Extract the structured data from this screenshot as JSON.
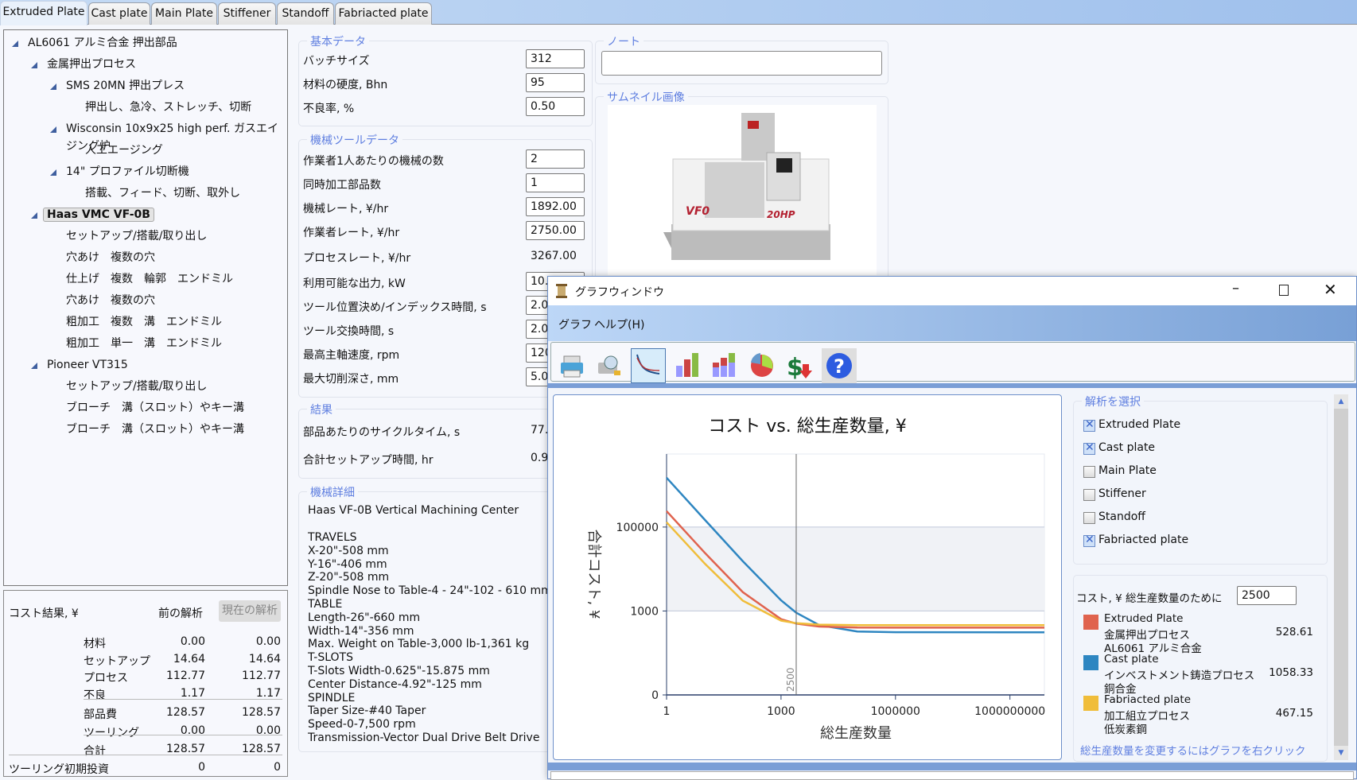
{
  "tabs": [
    "Extruded Plate",
    "Cast plate",
    "Main Plate",
    "Stiffener",
    "Standoff",
    "Fabriacted plate"
  ],
  "tree": [
    {
      "label": "AL6061 アルミ合金 押出部品",
      "level": 0,
      "toggle": true
    },
    {
      "label": "金属押出プロセス",
      "level": 1,
      "toggle": true
    },
    {
      "label": "SMS 20MN 押出プレス",
      "level": 2,
      "toggle": true
    },
    {
      "label": "押出し、急冷、ストレッチ、切断",
      "level": 3,
      "toggle": false
    },
    {
      "label": "Wisconsin 10x9x25 high perf. ガスエイジング炉",
      "level": 2,
      "toggle": true
    },
    {
      "label": "人工エージング",
      "level": 3,
      "toggle": false
    },
    {
      "label": "14\" プロファイル切断機",
      "level": 2,
      "toggle": true
    },
    {
      "label": "搭載、フィード、切断、取外し",
      "level": 3,
      "toggle": false
    },
    {
      "label": "Haas VMC VF-0B",
      "level": 1,
      "toggle": true,
      "selected": true
    },
    {
      "label": "セットアップ/搭載/取り出し",
      "level": 2,
      "toggle": false
    },
    {
      "label": "穴あけ　複数の穴",
      "level": 2,
      "toggle": false
    },
    {
      "label": "仕上げ　複数　輪郭　エンドミル",
      "level": 2,
      "toggle": false
    },
    {
      "label": "穴あけ　複数の穴",
      "level": 2,
      "toggle": false
    },
    {
      "label": "粗加工　複数　溝　エンドミル",
      "level": 2,
      "toggle": false
    },
    {
      "label": "粗加工　単一　溝　エンドミル",
      "level": 2,
      "toggle": false
    },
    {
      "label": "Pioneer VT315",
      "level": 1,
      "toggle": true
    },
    {
      "label": "セットアップ/搭載/取り出し",
      "level": 2,
      "toggle": false
    },
    {
      "label": "ブローチ　溝（スロット）やキー溝",
      "level": 2,
      "toggle": false
    },
    {
      "label": "ブローチ　溝（スロット）やキー溝",
      "level": 2,
      "toggle": false
    }
  ],
  "cost": {
    "title": "コスト結果, ¥",
    "prev_header": "前の解析",
    "current_button": "現在の解析",
    "rows": [
      {
        "label": "材料",
        "prev": "0.00",
        "cur": "0.00"
      },
      {
        "label": "セットアップ",
        "prev": "14.64",
        "cur": "14.64"
      },
      {
        "label": "プロセス",
        "prev": "112.77",
        "cur": "112.77"
      },
      {
        "label": "不良",
        "prev": "1.17",
        "cur": "1.17"
      },
      {
        "label": "部品費",
        "prev": "128.57",
        "cur": "128.57"
      },
      {
        "label": "ツーリング",
        "prev": "0.00",
        "cur": "0.00"
      },
      {
        "label": "合計",
        "prev": "128.57",
        "cur": "128.57"
      }
    ],
    "tooling": {
      "label": "ツーリング初期投資",
      "prev": "0",
      "cur": "0"
    }
  },
  "basic": {
    "title": "基本データ",
    "fields": [
      {
        "label": "バッチサイズ",
        "value": "312"
      },
      {
        "label": "材料の硬度, Bhn",
        "value": "95"
      },
      {
        "label": "不良率, %",
        "value": "0.50"
      }
    ]
  },
  "machine": {
    "title": "機械ツールデータ",
    "fields": [
      {
        "label": "作業者1人あたりの機械の数",
        "value": "2",
        "input": true
      },
      {
        "label": "同時加工部品数",
        "value": "1",
        "input": true
      },
      {
        "label": "機械レート, ¥/hr",
        "value": "1892.00",
        "input": true
      },
      {
        "label": "作業者レート, ¥/hr",
        "value": "2750.00",
        "input": true
      },
      {
        "label": "プロセスレート, ¥/hr",
        "value": "3267.00",
        "input": false
      },
      {
        "label": "利用可能な出力, kW",
        "value": "10.",
        "input": true
      },
      {
        "label": "ツール位置決め/インデックス時間, s",
        "value": "2.0",
        "input": true
      },
      {
        "label": "ツール交換時間, s",
        "value": "2.0",
        "input": true
      },
      {
        "label": "最高主軸速度, rpm",
        "value": "120",
        "input": true
      },
      {
        "label": "最大切削深さ, mm",
        "value": "5.0",
        "input": true
      }
    ]
  },
  "results": {
    "title": "結果",
    "fields": [
      {
        "label": "部品あたりのサイクルタイム, s",
        "value": "77."
      },
      {
        "label": "合計セットアップ時間, hr",
        "value": "0.9"
      }
    ]
  },
  "details": {
    "title": "機械詳細",
    "heading": "Haas  VF-0B Vertical Machining Center",
    "lines": [
      "TRAVELS",
      "X-20\"-508 mm",
      "Y-16\"-406 mm",
      "Z-20\"-508 mm",
      "Spindle Nose to Table-4 - 24\"-102 - 610 mm",
      "TABLE",
      "Length-26\"-660 mm",
      "Width-14\"-356 mm",
      "Max. Weight on Table-3,000 lb-1,361 kg",
      "T-SLOTS",
      "T-Slots Width-0.625\"-15.875 mm",
      "Center Distance-4.92\"-125 mm",
      "SPINDLE",
      "Taper Size-#40 Taper",
      "Speed-0-7,500 rpm",
      "Transmission-Vector Dual Drive Belt Drive"
    ]
  },
  "note": {
    "title": "ノート",
    "value": ""
  },
  "thumbnail": {
    "title": "サムネイル画像",
    "logo_text": "VF0",
    "badge_text": "20HP"
  },
  "graph_window": {
    "title": "グラフウィンドウ",
    "menu": [
      "グラフ",
      "ヘルプ(H)"
    ],
    "toolbar": [
      "printer-icon",
      "print-preview-icon",
      "line-chart-icon",
      "bar-chart-icon",
      "stacked-bar-chart-icon",
      "pie-chart-icon",
      "cost-reduction-icon",
      "help-icon"
    ],
    "active_tool": "line-chart-icon",
    "select_title": "解析を選択",
    "analyses": [
      {
        "label": "Extruded Plate",
        "checked": true
      },
      {
        "label": "Cast plate",
        "checked": true
      },
      {
        "label": "Main Plate",
        "checked": false
      },
      {
        "label": "Stiffener",
        "checked": false
      },
      {
        "label": "Standoff",
        "checked": false
      },
      {
        "label": "Fabriacted plate",
        "checked": true
      }
    ],
    "cost_for_label": "コスト, ¥ 総生産数量のために",
    "cost_for_value": "2500",
    "legend": [
      {
        "name": "Extruded Plate",
        "process": "金属押出プロセス",
        "material": "AL6061 アルミ合金",
        "value": "528.61",
        "color": "#e0634e"
      },
      {
        "name": "Cast plate",
        "process": "インベストメント鋳造プロセス",
        "material": "銅合金",
        "value": "1058.33",
        "color": "#2e86c1"
      },
      {
        "name": "Fabriacted plate",
        "process": "加工組立プロセス",
        "material": "低炭素鋼",
        "value": "467.15",
        "color": "#f0bd3a"
      }
    ],
    "hint": "総生産数量を変更するにはグラフを右クリック"
  },
  "chart_data": {
    "type": "line",
    "title": "コスト vs. 総生産数量, ¥",
    "xlabel": "総生産数量",
    "ylabel": "合計コスト, ¥",
    "x_scale": "log",
    "y_scale": "log",
    "xlim": [
      1,
      8000000000
    ],
    "ylim": [
      10,
      5500000
    ],
    "x_ticks": [
      {
        "v": 1,
        "label": "1"
      },
      {
        "v": 1000,
        "label": "1000"
      },
      {
        "v": 1000000,
        "label": "1000000"
      },
      {
        "v": 1000000000,
        "label": "1000000000"
      }
    ],
    "y_ticks": [
      {
        "v": 10,
        "label": "0"
      },
      {
        "v": 1000,
        "label": "1000"
      },
      {
        "v": 100000,
        "label": "100000"
      }
    ],
    "shaded_band": [
      1000,
      100000
    ],
    "marker": {
      "x": 2500,
      "label": "2500"
    },
    "grid": false,
    "series": [
      {
        "color": "#2e86c1",
        "x": [
          1,
          10,
          100,
          1000,
          2500,
          10000,
          100000,
          1000000,
          8000000000
        ],
        "y": [
          1500000,
          150000,
          15300,
          1800,
          910,
          460,
          325,
          312,
          310
        ]
      },
      {
        "color": "#e0634e",
        "x": [
          1,
          10,
          100,
          1000,
          2500,
          10000,
          100000,
          1000000,
          8000000000
        ],
        "y": [
          240000,
          24400,
          2800,
          640,
          500,
          425,
          402,
          400,
          400
        ]
      },
      {
        "color": "#f0bd3a",
        "x": [
          1,
          10,
          100,
          1000,
          2500,
          10000,
          100000,
          1000000,
          8000000000
        ],
        "y": [
          130000,
          13500,
          1760,
          590,
          512,
          473,
          461,
          460,
          460
        ]
      }
    ]
  }
}
